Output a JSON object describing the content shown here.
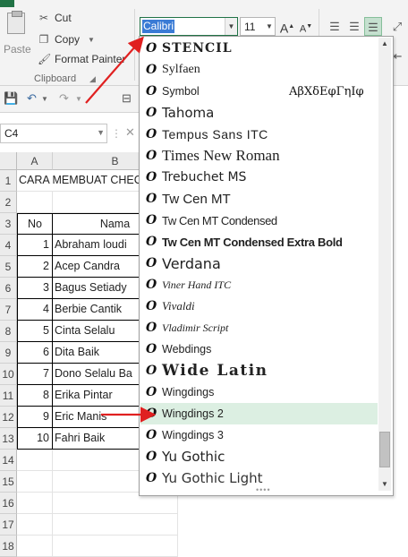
{
  "clipboard": {
    "paste_label": "Paste",
    "cut_label": "Cut",
    "copy_label": "Copy",
    "format_painter_label": "Format Painter",
    "group_label": "Clipboard"
  },
  "font": {
    "name_value": "Calibri",
    "size_value": "11",
    "grow_label": "A",
    "shrink_label": "A"
  },
  "namebox": {
    "value": "C4"
  },
  "formula_bar": {
    "cancel_icon": "✕"
  },
  "sheet": {
    "columns": [
      "A",
      "B"
    ],
    "rows": [
      "1",
      "2",
      "3",
      "4",
      "5",
      "6",
      "7",
      "8",
      "9",
      "10",
      "11",
      "12",
      "13",
      "14",
      "15",
      "16",
      "17",
      "18"
    ],
    "title": "CARA MEMBUAT CHEC",
    "header_no": "No",
    "header_nama": "Nama",
    "data": [
      {
        "no": "1",
        "nama": "Abraham loudi"
      },
      {
        "no": "2",
        "nama": "Acep Candra"
      },
      {
        "no": "3",
        "nama": "Bagus Setiady"
      },
      {
        "no": "4",
        "nama": "Berbie Cantik"
      },
      {
        "no": "5",
        "nama": "Cinta Selalu"
      },
      {
        "no": "6",
        "nama": "Dita Baik"
      },
      {
        "no": "7",
        "nama": "Dono Selalu Ba"
      },
      {
        "no": "8",
        "nama": "Erika Pintar"
      },
      {
        "no": "9",
        "nama": "Eric Manis"
      },
      {
        "no": "10",
        "nama": "Fahri Baik"
      }
    ]
  },
  "font_list": {
    "type_icon": "O",
    "symbol_sample": "ΑβΧδΕφΓηΙφ",
    "grip": "••••",
    "items": [
      "STENCIL",
      "Sylfaen",
      "Symbol",
      "Tahoma",
      "Tempus Sans ITC",
      "Times New Roman",
      "Trebuchet MS",
      "Tw Cen MT",
      "Tw Cen MT Condensed",
      "Tw Cen MT Condensed Extra Bold",
      "Verdana",
      "Viner Hand ITC",
      "Vivaldi",
      "Vladimir Script",
      "Webdings",
      "Wide Latin",
      "Wingdings",
      "Wingdings 2",
      "Wingdings 3",
      "Yu Gothic",
      "Yu Gothic Light"
    ],
    "highlighted": "Wingdings 2"
  },
  "colors": {
    "excel_green": "#217346",
    "selection_blue": "#3a7bd5",
    "highlight_row": "#dcefe2",
    "annotation_arrow": "#e02020"
  }
}
